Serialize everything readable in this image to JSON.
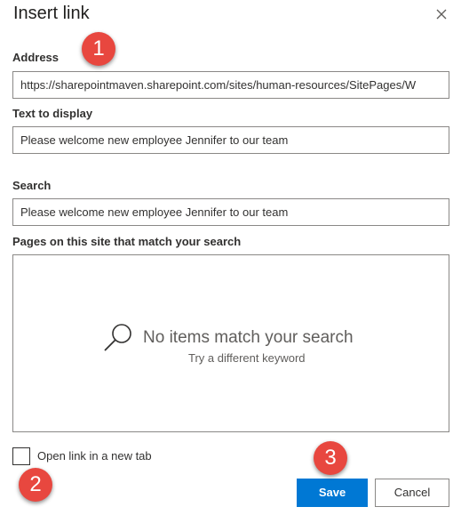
{
  "dialog": {
    "title": "Insert link",
    "address_label": "Address",
    "address_value": "https://sharepointmaven.sharepoint.com/sites/human-resources/SitePages/W",
    "text_label": "Text to display",
    "text_value": "Please welcome new employee Jennifer to our team",
    "search_label": "Search",
    "search_value": "Please welcome new employee Jennifer to our team",
    "results_label": "Pages on this site that match your search",
    "empty_title": "No items match your search",
    "empty_sub": "Try a different keyword",
    "new_tab_label": "Open link in a new tab",
    "save_label": "Save",
    "cancel_label": "Cancel"
  },
  "annotations": {
    "badge1": "1",
    "badge2": "2",
    "badge3": "3"
  },
  "colors": {
    "primary": "#0078d4",
    "badge": "#e8473f"
  },
  "icons": {
    "close": "close-icon",
    "search": "search-icon"
  }
}
